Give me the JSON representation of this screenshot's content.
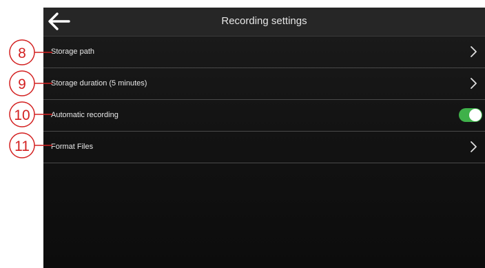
{
  "header": {
    "title": "Recording settings",
    "back_icon": "arrow-left-icon"
  },
  "settings": [
    {
      "label": "Storage path",
      "control": "chevron",
      "callout": "8"
    },
    {
      "label": "Storage duration (5 minutes)",
      "control": "chevron",
      "callout": "9"
    },
    {
      "label": "Automatic recording",
      "control": "toggle",
      "toggle_on": true,
      "callout": "10"
    },
    {
      "label": "Format Files",
      "control": "chevron",
      "callout": "11"
    }
  ],
  "colors": {
    "toggle_on": "#3fb14a",
    "callout": "#d32020",
    "background": "#141414"
  }
}
